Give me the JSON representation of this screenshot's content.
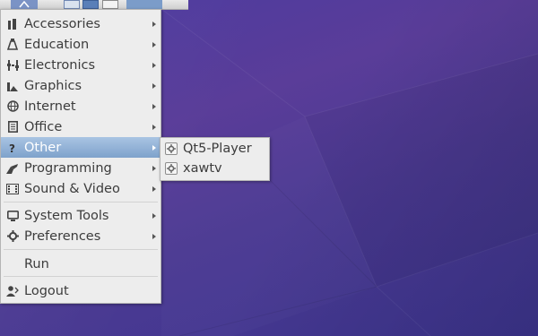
{
  "main_menu": {
    "items": [
      {
        "label": "Accessories",
        "icon": "accessories-icon",
        "submenu": true
      },
      {
        "label": "Education",
        "icon": "education-icon",
        "submenu": true
      },
      {
        "label": "Electronics",
        "icon": "electronics-icon",
        "submenu": true
      },
      {
        "label": "Graphics",
        "icon": "graphics-icon",
        "submenu": true
      },
      {
        "label": "Internet",
        "icon": "internet-icon",
        "submenu": true
      },
      {
        "label": "Office",
        "icon": "office-icon",
        "submenu": true
      },
      {
        "label": "Other",
        "icon": "other-icon",
        "submenu": true,
        "active": true
      },
      {
        "label": "Programming",
        "icon": "programming-icon",
        "submenu": true
      },
      {
        "label": "Sound & Video",
        "icon": "sound-video-icon",
        "submenu": true
      },
      {
        "label": "System Tools",
        "icon": "system-tools-icon",
        "submenu": true
      },
      {
        "label": "Preferences",
        "icon": "preferences-icon",
        "submenu": true
      },
      {
        "label": "Run",
        "icon": "",
        "submenu": false
      },
      {
        "label": "Logout",
        "icon": "logout-icon",
        "submenu": false
      }
    ]
  },
  "sub_menu": {
    "items": [
      {
        "label": "Qt5-Player",
        "icon": "gear-icon"
      },
      {
        "label": "xawtv",
        "icon": "gear-icon"
      }
    ]
  },
  "colors": {
    "highlight": "#8fb0d6",
    "menu_bg": "#ededed",
    "desktop": "#4f3a98"
  }
}
